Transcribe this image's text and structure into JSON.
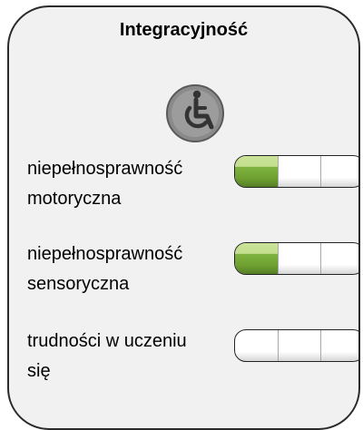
{
  "panel": {
    "title": "Integracyjność",
    "icon": "wheelchair-icon",
    "accent_color": "#7fb33f",
    "items": [
      {
        "label_line1": "niepełnosprawność",
        "label_line2": "motoryczna",
        "level": 1,
        "max_level": 3
      },
      {
        "label_line1": "niepełnosprawność",
        "label_line2": "sensoryczna",
        "level": 1,
        "max_level": 3
      },
      {
        "label_line1": "trudności w uczeniu",
        "label_line2": "się",
        "level": 0,
        "max_level": 3
      }
    ]
  }
}
